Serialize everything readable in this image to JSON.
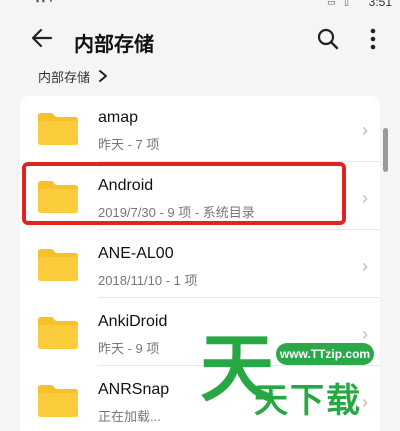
{
  "status_bar": {
    "time": "3:51"
  },
  "toolbar": {
    "title": "内部存储"
  },
  "breadcrumb": {
    "label": "内部存储"
  },
  "files": [
    {
      "name": "amap",
      "meta": "昨天 - 7 项"
    },
    {
      "name": "Android",
      "meta": "2019/7/30 - 9 项 - 系统目录"
    },
    {
      "name": "ANE-AL00",
      "meta": "2018/11/10 - 1 项"
    },
    {
      "name": "AnkiDroid",
      "meta": "昨天 - 9 项"
    },
    {
      "name": "ANRSnap",
      "meta": "正在加载..."
    }
  ],
  "colors": {
    "folder": "#f8c02a",
    "highlight": "#e32222",
    "watermark": "#28a745"
  },
  "icons": [
    "back-arrow-icon",
    "search-icon",
    "more-vertical-icon",
    "chevron-right-icon",
    "folder-icon"
  ],
  "watermark": {
    "url": "www.TTzip.com",
    "mark": "天",
    "text": "天下载"
  }
}
